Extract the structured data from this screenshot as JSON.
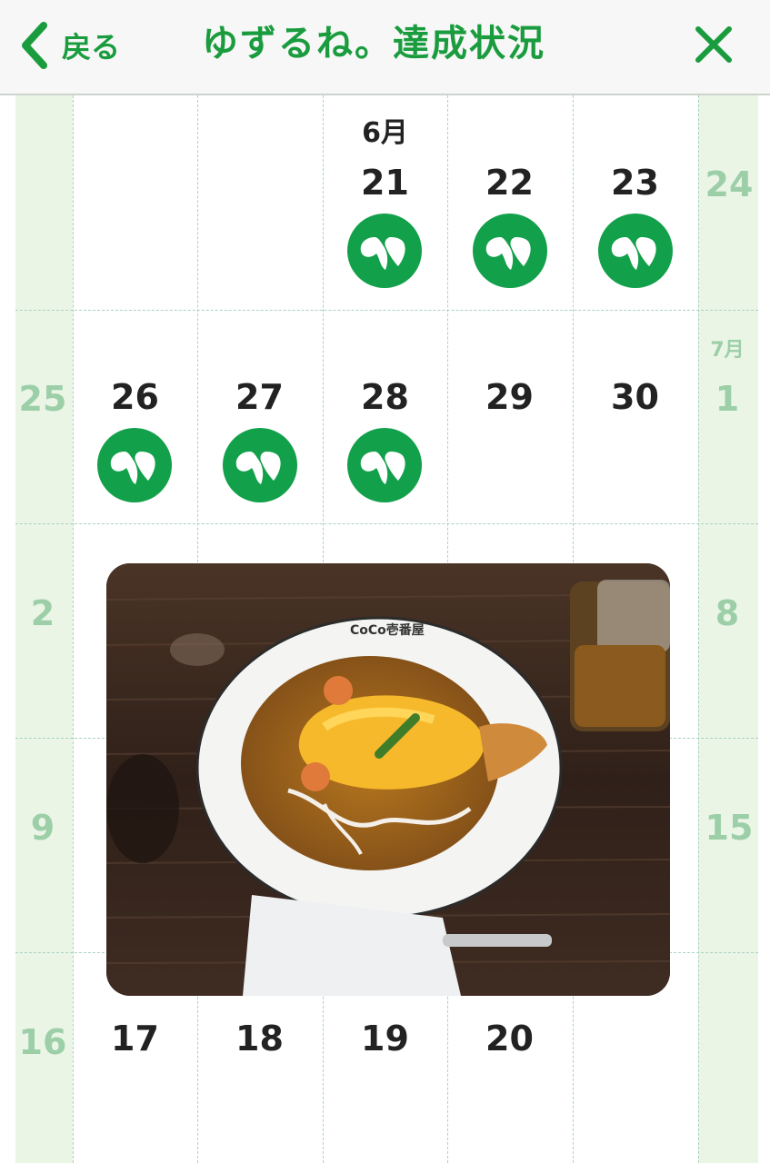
{
  "header": {
    "back_label": "戻る",
    "title": "ゆずるね。達成状況",
    "back_icon": "chevron-left-icon",
    "close_icon": "close-icon",
    "accent_color": "#1a9c3e"
  },
  "calendar": {
    "row1": {
      "month": "6月",
      "days": [
        "21",
        "22",
        "23"
      ],
      "side_right": "24"
    },
    "row2": {
      "side_left": "25",
      "days": [
        "26",
        "27",
        "28",
        "29",
        "30"
      ],
      "side_right_month": "7月",
      "side_right": "1"
    },
    "row3": {
      "side_left": "2",
      "side_right": "8"
    },
    "row4": {
      "side_left": "9",
      "side_right": "15"
    },
    "row5": {
      "side_left": "16",
      "days": [
        "17",
        "18",
        "19",
        "20"
      ]
    },
    "achieved_days": [
      "21",
      "22",
      "23",
      "26",
      "27",
      "28"
    ],
    "badge_icon": "leaf-heart-icon",
    "badge_color": "#12a04a",
    "weekend_color": "#eaf5e6"
  },
  "photo": {
    "plate_text": "CoCo壱番屋",
    "icon": "food-photo"
  }
}
